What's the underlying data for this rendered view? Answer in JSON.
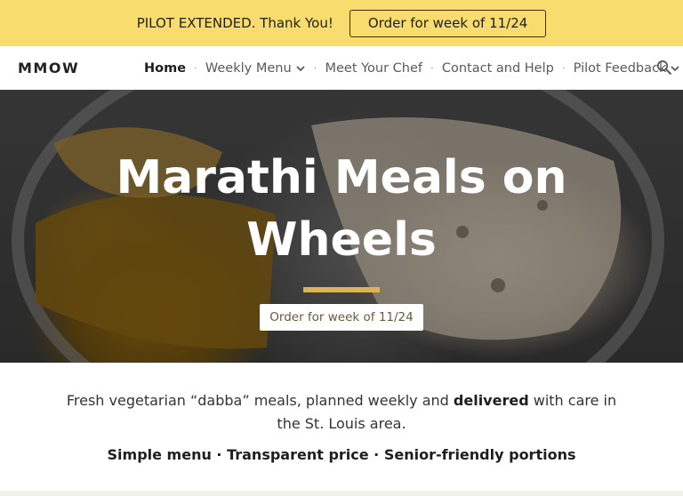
{
  "banner": {
    "text": "PILOT EXTENDED. Thank You!",
    "button_label": "Order for week of 11/24",
    "background": "#f8dc6e"
  },
  "nav": {
    "logo": "MMOW",
    "items": [
      {
        "label": "Home",
        "active": true,
        "dropdown": false
      },
      {
        "label": "Weekly Menu",
        "active": false,
        "dropdown": true
      },
      {
        "label": "Meet Your Chef",
        "active": false,
        "dropdown": false
      },
      {
        "label": "Contact and Help",
        "active": false,
        "dropdown": false
      },
      {
        "label": "Pilot Feedback",
        "active": false,
        "dropdown": true
      }
    ],
    "separator": "·",
    "search_icon": "search-icon"
  },
  "hero": {
    "title": "Marathi Meals on Wheels",
    "button_label": "Order for week of 11/24",
    "accent_color": "#d9b45a"
  },
  "intro": {
    "text_before": "Fresh vegetarian “dabba” meals, planned weekly and ",
    "text_bold": "delivered",
    "text_after": " with care in the St. Louis area.",
    "tagline": "Simple menu · Transparent price · Senior-friendly portions"
  }
}
